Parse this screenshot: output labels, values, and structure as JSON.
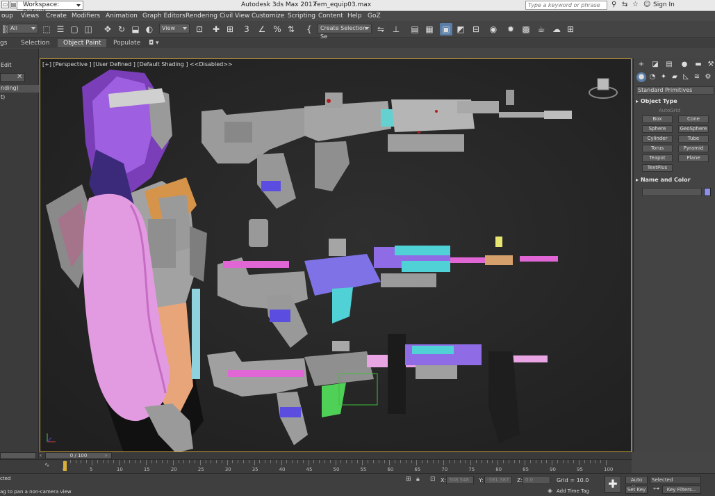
{
  "titlebar": {
    "workspace": "Workspace: Default",
    "app_title": "Autodesk 3ds Max 2017",
    "file_name": "fem_equip03.max",
    "search_placeholder": "Type a keyword or phrase",
    "sign_in": "Sign In"
  },
  "menu": [
    "oup",
    "Views",
    "Create",
    "Modifiers",
    "Animation",
    "Graph Editors",
    "Rendering",
    "Civil View",
    "Customize",
    "Scripting",
    "Content",
    "Help",
    "GoZ"
  ],
  "toolbar": {
    "filter_value": "All",
    "view_value": "View",
    "selection_set": "Create Selection Se"
  },
  "ribbon": {
    "tabs": [
      "gs",
      "Selection",
      "Object Paint",
      "Populate"
    ],
    "active": "Object Paint"
  },
  "left_panel": {
    "items": [
      "Edit",
      "nding)",
      "t)"
    ]
  },
  "viewport": {
    "label": "[+] [Perspective ] [User Defined ] [Default Shading ]  <<Disabled>>"
  },
  "command_panel": {
    "primitive_type": "Standard Primitives",
    "object_type_title": "Object Type",
    "autogrid": "AutoGrid",
    "buttons": [
      "Box",
      "Cone",
      "Sphere",
      "GeoSphere",
      "Cylinder",
      "Tube",
      "Torus",
      "Pyramid",
      "Teapot",
      "Plane",
      "TextPlus"
    ],
    "name_color_title": "Name and Color",
    "swatch_color": "#8d8fe6"
  },
  "timeline": {
    "slider_label": "0 / 100",
    "ticks": [
      "0",
      "5",
      "10",
      "15",
      "20",
      "25",
      "30",
      "35",
      "40",
      "45",
      "50",
      "55",
      "60",
      "65",
      "70",
      "75",
      "80",
      "85",
      "90",
      "95",
      "100"
    ]
  },
  "status": {
    "line1": "cted",
    "line2": "ag to pan a non-camera view",
    "x_label": "X:",
    "x_value": "508.548",
    "y_label": "Y:",
    "y_value": "-381.387",
    "z_label": "Z:",
    "z_value": "0.0",
    "grid": "Grid = 10.0",
    "add_time_tag": "Add Time Tag",
    "auto_key": "Auto Key",
    "set_key": "Set Key",
    "selected": "Selected",
    "key_filters": "Key Filters..."
  },
  "colors": {
    "accent": "#5a7ea8",
    "viewport_border": "#c9a23a",
    "pink": "#f2a0e0",
    "purple": "#8d6ae6",
    "cyan": "#4fd1d6",
    "magenta": "#e066d6"
  }
}
